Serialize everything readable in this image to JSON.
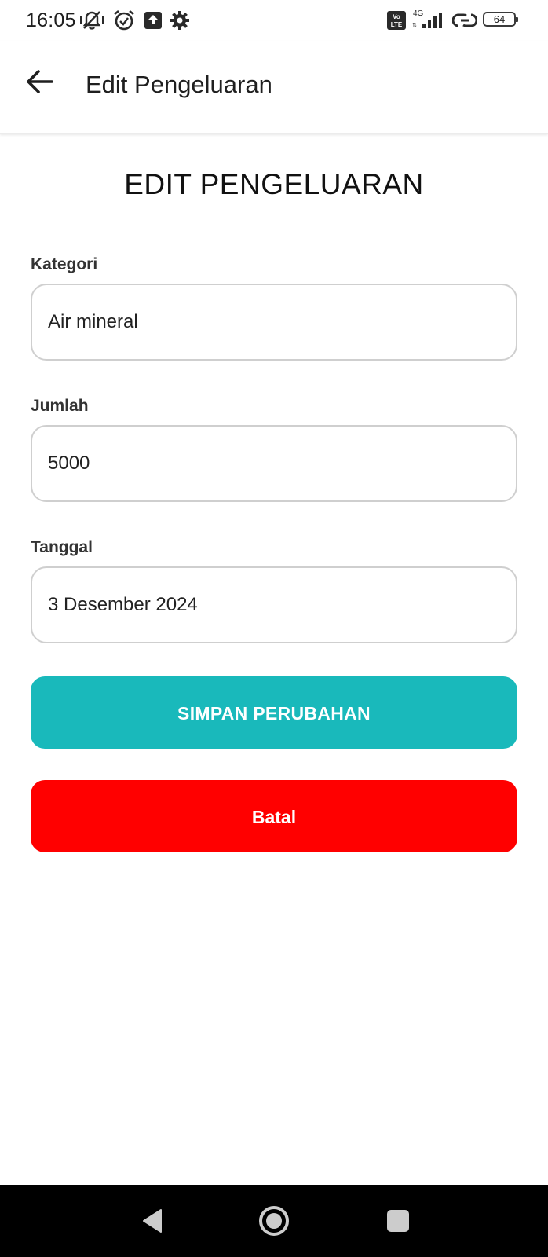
{
  "status_bar": {
    "time": "16:05",
    "battery_level": "64",
    "network": "4G",
    "volte": "Vo LTE",
    "icons": [
      "mute-vibrate-icon",
      "alarm-icon",
      "upload-icon",
      "settings-icon",
      "volte-icon",
      "signal-icon",
      "hotspot-icon",
      "battery-icon"
    ]
  },
  "app_bar": {
    "title": "Edit Pengeluaran",
    "back_icon": "arrow-left-icon"
  },
  "form": {
    "heading": "EDIT PENGELUARAN",
    "kategori": {
      "label": "Kategori",
      "value": "Air mineral"
    },
    "jumlah": {
      "label": "Jumlah",
      "value": "5000"
    },
    "tanggal": {
      "label": "Tanggal",
      "value": "3 Desember 2024"
    }
  },
  "buttons": {
    "save_label": "SIMPAN PERUBAHAN",
    "cancel_label": "Batal"
  },
  "colors": {
    "save_button": "#19b9bb",
    "cancel_button": "#ff0000",
    "field_border": "#cfcfcf"
  },
  "nav_bar": {
    "icons": [
      "back-triangle-icon",
      "home-circle-icon",
      "recents-square-icon"
    ]
  }
}
